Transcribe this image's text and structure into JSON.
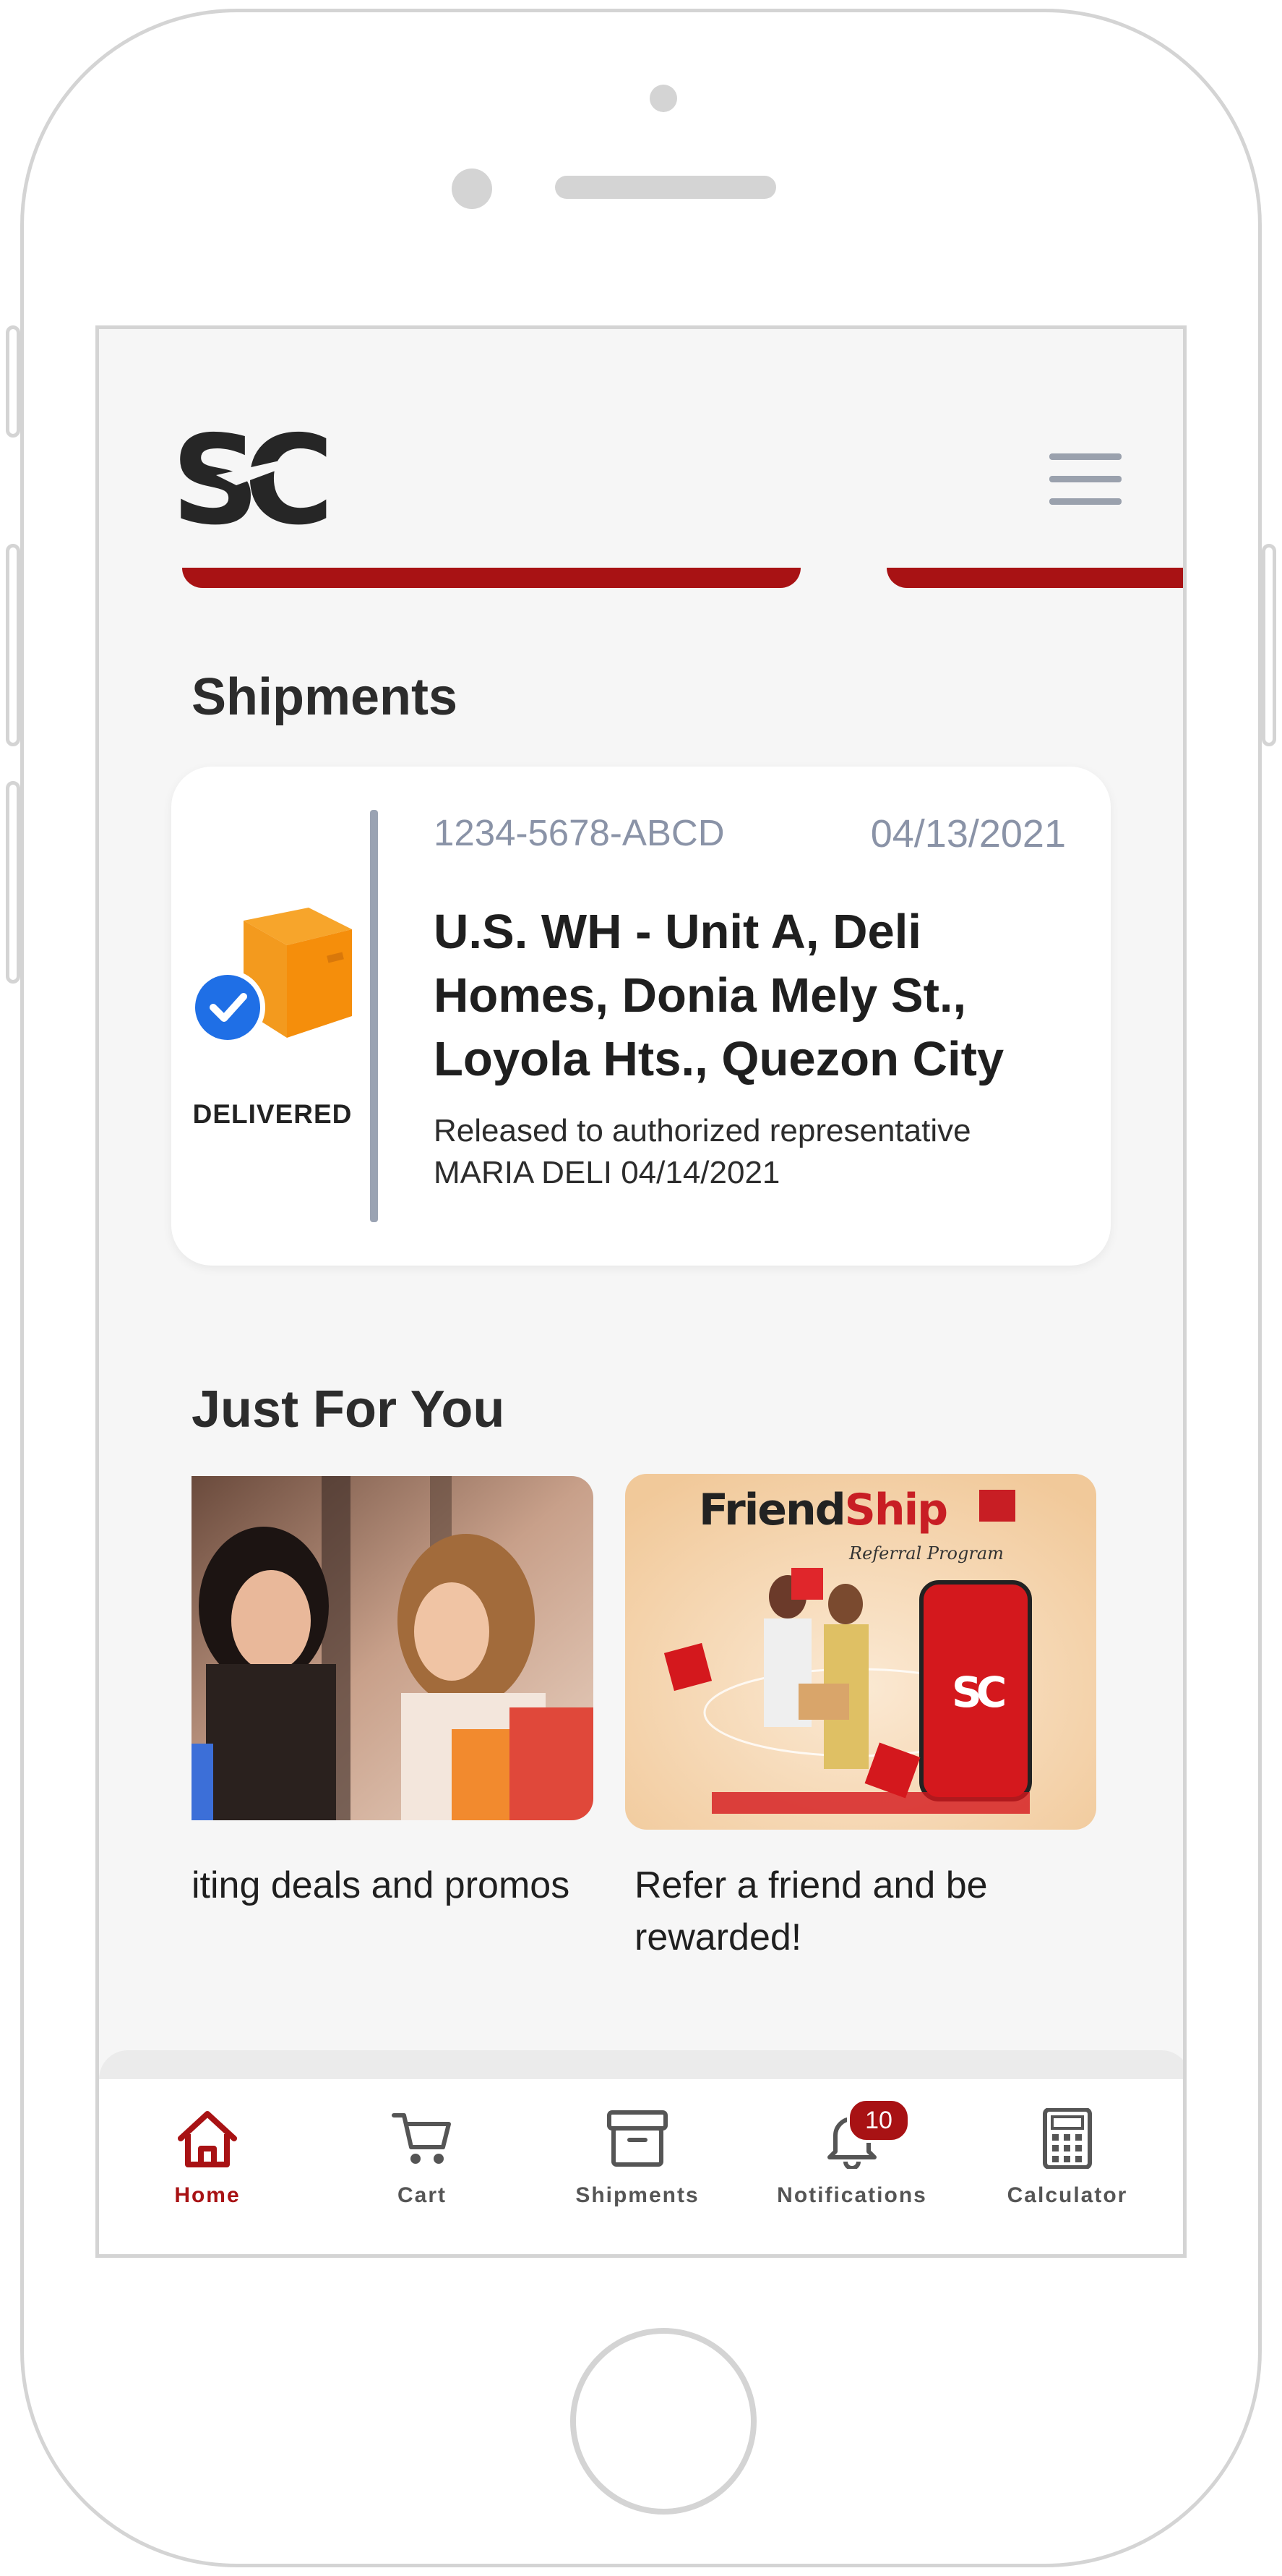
{
  "header": {
    "logo_text": "SC",
    "menu_icon": "hamburger-menu-icon"
  },
  "shipments": {
    "title": "Shipments",
    "card": {
      "tracking_number": "1234-5678-ABCD",
      "date": "04/13/2021",
      "status": "DELIVERED",
      "address": "U.S. WH - Unit A, Deli Homes, Donia Mely St., Loyola Hts., Quezon City",
      "note_line1": "Released to authorized representative",
      "note_line2": "MARIA DELI 04/14/2021"
    }
  },
  "just_for_you": {
    "title": "Just For You",
    "items": [
      {
        "caption": "iting deals and promos"
      },
      {
        "caption": "Refer a friend and be rewarded!",
        "brand": "FriendShip",
        "subtitle": "Referral Program",
        "app_logo": "SC"
      }
    ]
  },
  "nav": {
    "items": [
      {
        "label": "Home",
        "icon": "home-icon"
      },
      {
        "label": "Cart",
        "icon": "cart-icon"
      },
      {
        "label": "Shipments",
        "icon": "box-icon"
      },
      {
        "label": "Notifications",
        "icon": "bell-icon",
        "badge": "10"
      },
      {
        "label": "Calculator",
        "icon": "calculator-icon"
      }
    ]
  },
  "colors": {
    "accent": "#a81214",
    "muted": "#8a93a7",
    "screen_bg": "#f6f6f6"
  }
}
